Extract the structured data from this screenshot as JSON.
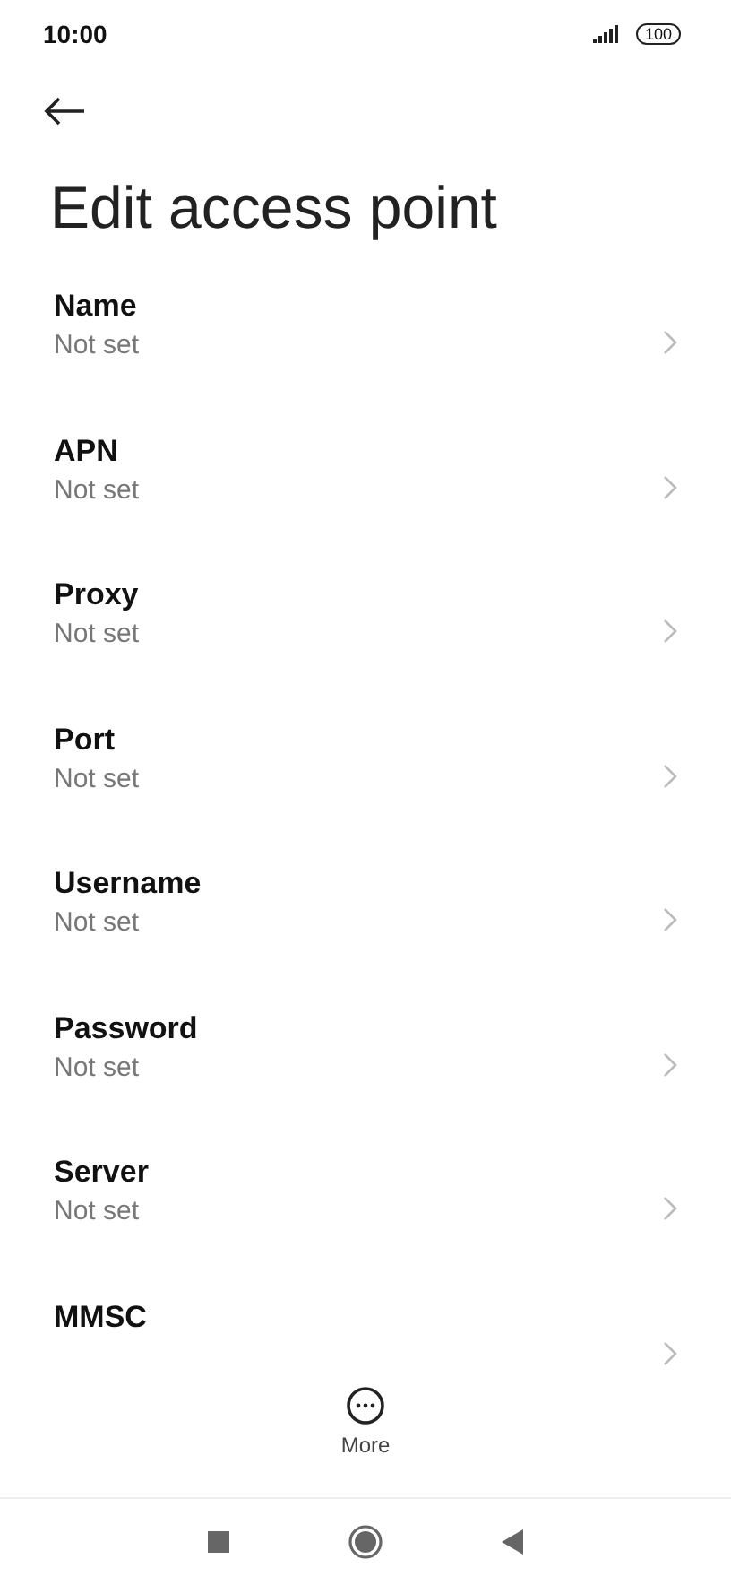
{
  "status_bar": {
    "time": "10:00",
    "battery": "100"
  },
  "title": "Edit access point",
  "settings": [
    {
      "label": "Name",
      "value": "Not set"
    },
    {
      "label": "APN",
      "value": "Not set"
    },
    {
      "label": "Proxy",
      "value": "Not set"
    },
    {
      "label": "Port",
      "value": "Not set"
    },
    {
      "label": "Username",
      "value": "Not set"
    },
    {
      "label": "Password",
      "value": "Not set"
    },
    {
      "label": "Server",
      "value": "Not set"
    },
    {
      "label": "MMSC"
    }
  ],
  "bottom_action": {
    "label": "More"
  }
}
